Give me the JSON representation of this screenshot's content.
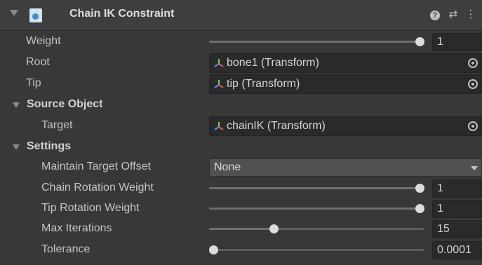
{
  "header": {
    "title": "Chain IK Constraint",
    "help_icon": "?",
    "preset_icon": "⇄",
    "menu_icon": "⋮"
  },
  "fields": {
    "weight": {
      "label": "Weight",
      "value": "1",
      "fraction": 1.0
    },
    "root": {
      "label": "Root",
      "value": "bone1 (Transform)"
    },
    "tip": {
      "label": "Tip",
      "value": "tip (Transform)"
    },
    "source_object": {
      "label": "Source Object"
    },
    "target": {
      "label": "Target",
      "value": "chainIK (Transform)"
    },
    "settings": {
      "label": "Settings"
    },
    "maintain_target_offset": {
      "label": "Maintain Target Offset",
      "value": "None"
    },
    "chain_rotation_weight": {
      "label": "Chain Rotation Weight",
      "value": "1",
      "fraction": 1.0
    },
    "tip_rotation_weight": {
      "label": "Tip Rotation Weight",
      "value": "1",
      "fraction": 1.0
    },
    "max_iterations": {
      "label": "Max Iterations",
      "value": "15",
      "fraction": 0.3
    },
    "tolerance": {
      "label": "Tolerance",
      "value": "0.0001",
      "fraction": 0.0
    }
  },
  "colors": {
    "background": "#383838",
    "field_background": "#2a2a2a",
    "thumb": "#dcdcdc"
  }
}
